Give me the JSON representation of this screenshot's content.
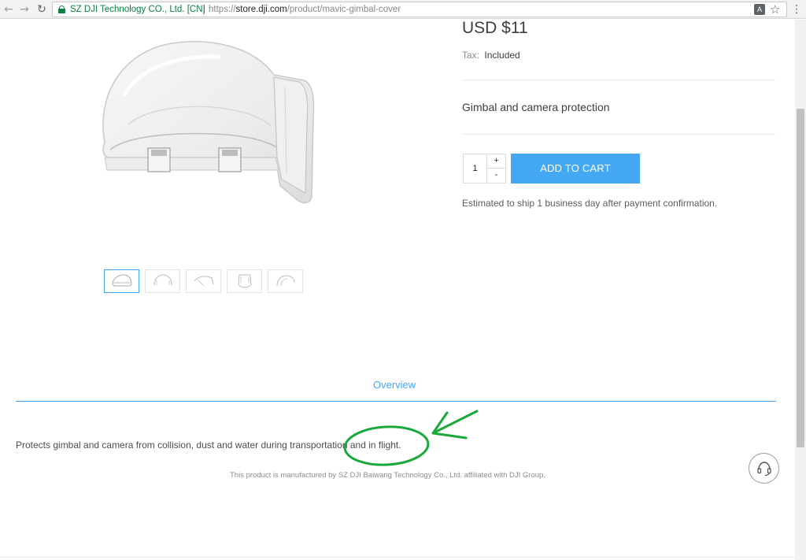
{
  "browser": {
    "site_identity": "SZ DJI Technology CO., Ltd. [CN]",
    "url_scheme": "https://",
    "url_host": "store.dji.com",
    "url_path": "/product/mavic-gimbal-cover",
    "icons": [
      "back-arrow-icon",
      "forward-arrow-icon",
      "reload-icon",
      "lock-icon",
      "translate-icon",
      "star-icon",
      "menu-icon"
    ]
  },
  "product": {
    "price": "USD $11",
    "tax_label": "Tax:",
    "tax_value": "Included",
    "short_description": "Gimbal and camera protection",
    "quantity": "1",
    "qty_plus": "+",
    "qty_minus": "-",
    "add_to_cart_label": "ADD TO CART",
    "shipping_note": "Estimated to ship 1 business day after payment confirmation.",
    "thumbnail_count": 5,
    "active_thumbnail": 1
  },
  "overview": {
    "tab_label": "Overview",
    "text": "Protects gimbal and camera from collision, dust and water during transportation and in flight.",
    "manufacturer_note": "This product is manufactured by SZ DJI Baiwang Technology Co., Ltd. affiliated with DJI Group."
  },
  "colors": {
    "accent": "#44a8f2",
    "secure_green": "#0b8043",
    "annotation_green": "#1aa83a",
    "text": "#3b3e40"
  },
  "support": {
    "icon": "headset-icon"
  }
}
